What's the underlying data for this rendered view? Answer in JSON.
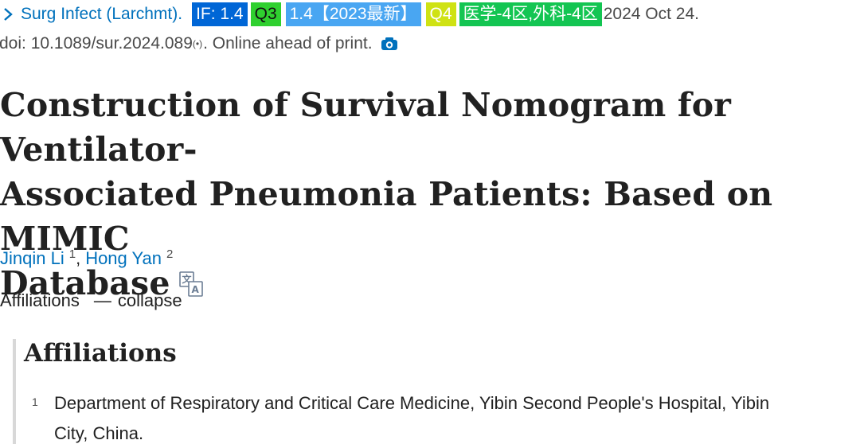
{
  "citation": {
    "journal": "Surg Infect (Larchmt).",
    "badges": [
      {
        "text": "IF: 1.4",
        "bg": "#0066d6",
        "fg": "#ffffff"
      },
      {
        "text": "Q3",
        "bg": "#2fd02f",
        "fg": "#111111"
      },
      {
        "text": "1.4【2023最新】",
        "bg": "#49a6f2",
        "fg": "#ffffff"
      },
      {
        "text": "Q4",
        "bg": "#cfe213",
        "fg": "#ffffff"
      },
      {
        "text": "医学-4区,外科-4区",
        "bg": "#13c552",
        "fg": "#ffffff"
      }
    ],
    "date": "2024 Oct 24.",
    "doi_text": "doi: 10.1089/sur.2024.089",
    "doi_suffix": "(•)",
    "ahead": ". Online ahead of print."
  },
  "article": {
    "title_line1": "Construction of Survival Nomogram for Ventilator-",
    "title_line2": "Associated Pneumonia Patients: Based on MIMIC",
    "title_line3": "Database"
  },
  "authors": [
    {
      "name": "Jinqin Li",
      "sup": "1"
    },
    {
      "name": "Hong Yan",
      "sup": "2"
    }
  ],
  "author_separator": ",",
  "affiliations_toggle": {
    "label": "Affiliations",
    "sign": "—",
    "action": "collapse"
  },
  "affiliations": {
    "heading": "Affiliations",
    "items": [
      {
        "num": "1",
        "line1": "Department of Respiratory and Critical Care Medicine, Yibin Second People's Hospital, Yibin",
        "line2": "City, China."
      }
    ]
  },
  "colors": {
    "link": "#0071bc",
    "text": "#212121",
    "muted": "#4a4a4a"
  },
  "icons": [
    "chevron-right-icon",
    "camera-icon",
    "translate-icon"
  ]
}
